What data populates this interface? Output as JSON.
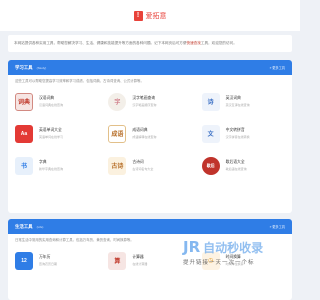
{
  "header": {
    "logo_char": "!",
    "brand": "爱拓意"
  },
  "intro": {
    "text_prefix": "本网站提供各种实用工具，帮助您解决学习、生活、健康和技能提升等方面的各种问题。记下本网页后可方便",
    "highlight": "快速查找",
    "text_suffix": "工具，欢迎您的访问。"
  },
  "sections": [
    {
      "title": "学习工具",
      "sub": "(Study)",
      "more": "» 更多工具",
      "desc": "这些工具可以帮助您提高学习效率和学习成绩，包括词典、古诗词查询、公式计算等。",
      "items": [
        {
          "icon": "dictionary-icon",
          "glyph": "词典",
          "title": "汉语词典",
          "desc": "汉语词典在线查询"
        },
        {
          "icon": "character-icon",
          "glyph": "字",
          "title": "汉字笔画查询",
          "desc": "汉字笔画顺序查询"
        },
        {
          "icon": "poem-icon",
          "glyph": "诗",
          "title": "英汉词典",
          "desc": "英汉互译在线查询"
        },
        {
          "icon": "english-icon",
          "glyph": "Aa",
          "title": "英语单词大全",
          "desc": "英语单词在线学习"
        },
        {
          "icon": "idiom-icon",
          "glyph": "成语",
          "title": "成语词典",
          "desc": "成语解释在线查询"
        },
        {
          "icon": "document-icon",
          "glyph": "文",
          "title": "中文转拼音",
          "desc": "汉字拼音在线转换"
        },
        {
          "icon": "book-icon",
          "glyph": "书",
          "title": "字典",
          "desc": "新华字典在线查询"
        },
        {
          "icon": "ancient-poem-icon",
          "glyph": "古诗",
          "title": "古诗词",
          "desc": "古诗词名句大全"
        },
        {
          "icon": "seal-icon",
          "glyph": "歇后",
          "title": "歇后语大全",
          "desc": "歇后语在线查询"
        }
      ]
    },
    {
      "title": "生活工具",
      "sub": "(Life)",
      "more": "» 更多工具",
      "desc": "日常生活中常用的实用查询和计算工具，包括万年历、黄历查询、时间换算等。",
      "items": [
        {
          "icon": "calendar-icon",
          "glyph": "12",
          "title": "万年历",
          "desc": "查询农历日期"
        },
        {
          "icon": "abacus-icon",
          "glyph": "算",
          "title": "计算器",
          "desc": "在线计算器"
        },
        {
          "icon": "clock-icon",
          "glyph": "◷",
          "title": "时间换算",
          "desc": "时间单位换算"
        }
      ]
    }
  ],
  "watermark": {
    "mark": "JR",
    "text": "自动秒收录",
    "sub": "提升链接一天一次一个标"
  }
}
